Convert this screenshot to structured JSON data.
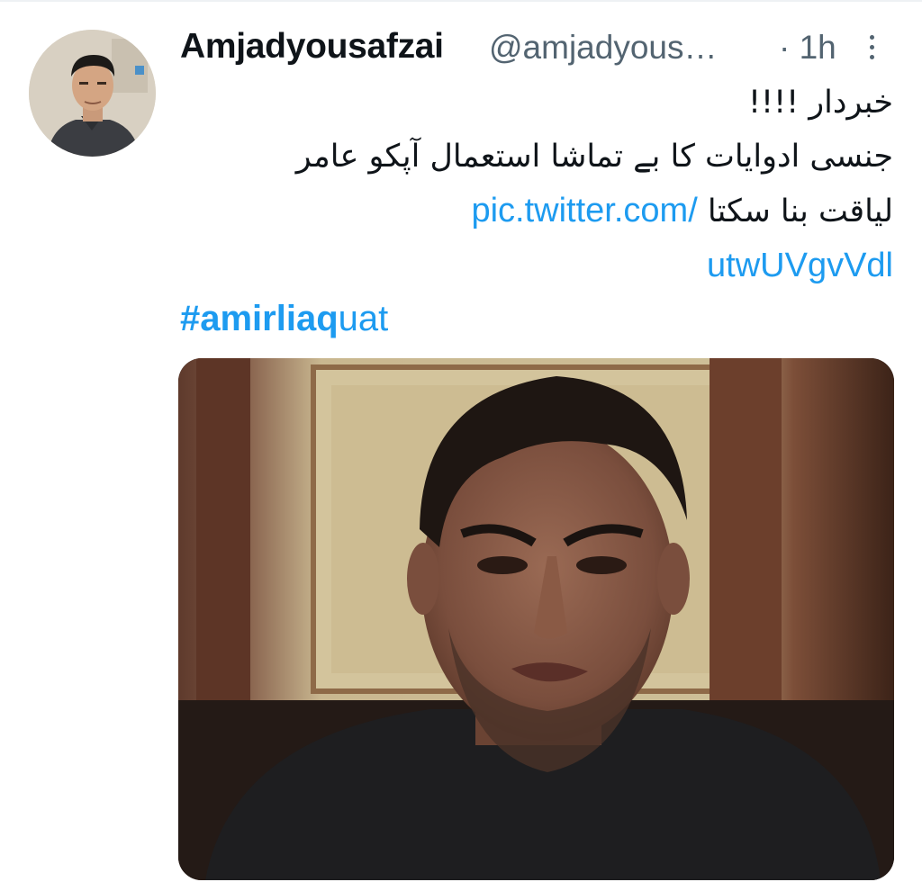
{
  "tweet": {
    "author": {
      "display_name": "Amjadyousafzai",
      "handle": "@amjadyous…"
    },
    "separator": "·",
    "time": "1h",
    "text_lines": [
      "خبردار !!!!",
      "جنسی ادوایات کا بے تماشا استعمال آپکو عامر",
      "لیاقت  بنا سکتا"
    ],
    "link_part1": "pic.twitter.com/",
    "link_part2": "utwUVgvVdl",
    "hashtag_bold": "#amirliaq",
    "hashtag_rest": "uat"
  },
  "icons": {
    "more": "more-vertical-icon"
  },
  "colors": {
    "text": "#0f1419",
    "secondary": "#536471",
    "link": "#1d9bf0"
  }
}
